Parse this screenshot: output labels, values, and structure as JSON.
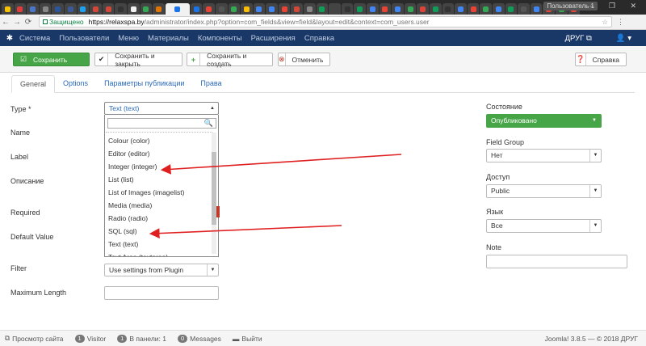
{
  "browser": {
    "profile_label": "Пользователь 1",
    "window_controls": "– ❐ ✕",
    "security_label": "Защищено",
    "url_host": "https://relaxspa.by",
    "url_path": "/administrator/index.php?option=com_fields&view=field&layout=edit&context=com_users.user",
    "tab_colors": [
      "#f7c300",
      "#e23b3b",
      "#4a76c9",
      "#888",
      "#2b579a",
      "#3b5998",
      "#1da1f2",
      "#d44638",
      "#d44638",
      "#333",
      "#f0f0f0",
      "#34a853",
      "#e37400",
      "#1a73e8",
      "#1a73e8",
      "#ea4335",
      "#555",
      "#34a853",
      "#fbbc05",
      "#4285f4",
      "#4285f4",
      "#ea4335",
      "#d44638",
      "#888",
      "#0f9d58",
      "#444",
      "#333",
      "#0f9d58",
      "#4285f4",
      "#ea4335",
      "#4285f4",
      "#34a853",
      "#db4437",
      "#0f9d58",
      "#333",
      "#4285f4",
      "#ea4335",
      "#34a853",
      "#4285f4",
      "#0f9d58",
      "#555",
      "#4285f4",
      "#ea4335",
      "#34a853",
      "#ea4335"
    ]
  },
  "navbar": {
    "items": [
      "Система",
      "Пользователи",
      "Меню",
      "Материалы",
      "Компоненты",
      "Расширения",
      "Справка"
    ],
    "site_label": "ДРУГ",
    "user_icon": "user-icon"
  },
  "toolbar": {
    "save_label": "Сохранить",
    "save_close_label": "Сохранить и закрыть",
    "save_new_label": "Сохранить и создать",
    "cancel_label": "Отменить",
    "help_label": "Справка"
  },
  "tabs": [
    {
      "label": "General",
      "active": true
    },
    {
      "label": "Options",
      "active": false
    },
    {
      "label": "Параметры публикации",
      "active": false
    },
    {
      "label": "Права",
      "active": false
    }
  ],
  "form": {
    "type_label": "Type *",
    "type_value": "Text (text)",
    "name_label": "Name",
    "label_label": "Label",
    "description_label": "Описание",
    "required_label": "Required",
    "default_label": "Default Value",
    "filter_label": "Filter",
    "filter_value": "Use settings from Plugin",
    "maxlen_label": "Maximum Length"
  },
  "dropdown": {
    "options": [
      "Colour (color)",
      "Editor (editor)",
      "Integer (integer)",
      "List (list)",
      "List of Images (imagelist)",
      "Media (media)",
      "Radio (radio)",
      "SQL (sql)",
      "Text (text)",
      "Text Area (textarea)"
    ]
  },
  "sidebar": {
    "state_label": "Состояние",
    "state_value": "Опубликовано",
    "field_group_label": "Field Group",
    "field_group_value": "Нет",
    "access_label": "Доступ",
    "access_value": "Public",
    "language_label": "Язык",
    "language_value": "Все",
    "note_label": "Note"
  },
  "statusbar": {
    "view_site": "Просмотр сайта",
    "visitor_count": "1",
    "visitor_label": "Visitor",
    "panel_count": "1",
    "panel_label": "В панели: 1",
    "messages_count": "0",
    "messages_label": "Messages",
    "logout_label": "Выйти",
    "version": "Joomla! 3.8.5 — © 2018 ДРУГ"
  },
  "colors": {
    "navbar": "#1a3867",
    "save_green": "#46a546",
    "annotation_red": "#e02020"
  }
}
